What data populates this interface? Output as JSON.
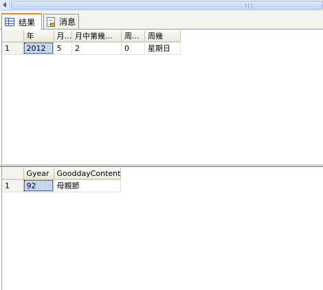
{
  "tabs": [
    {
      "label": "结果",
      "icon": "results-grid-icon",
      "active": true
    },
    {
      "label": "消息",
      "icon": "messages-icon",
      "active": false
    }
  ],
  "result1": {
    "columns": [
      "年",
      "月...",
      "月中第幾...",
      "周...",
      "周幾"
    ],
    "rows": [
      {
        "row_num": "1",
        "cells": [
          "2012",
          "5",
          "2",
          "0",
          "星期日"
        ]
      }
    ]
  },
  "result2": {
    "columns": [
      "Gyear",
      "GooddayContent"
    ],
    "rows": [
      {
        "row_num": "1",
        "cells": [
          "92",
          "母親節"
        ]
      }
    ]
  },
  "colors": {
    "tab_accent": "#e68b2c",
    "selected_cell": "#c6d6f4",
    "header_bg": "#ebeadb"
  }
}
